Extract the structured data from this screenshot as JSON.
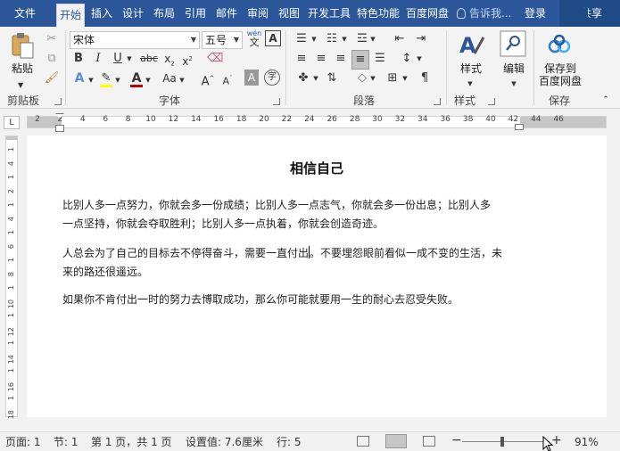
{
  "tabs": [
    {
      "label": "文件"
    },
    {
      "label": "开始"
    },
    {
      "label": "插入"
    },
    {
      "label": "设计"
    },
    {
      "label": "布局"
    },
    {
      "label": "引用"
    },
    {
      "label": "邮件"
    },
    {
      "label": "审阅"
    },
    {
      "label": "视图"
    },
    {
      "label": "开发工具"
    },
    {
      "label": "特色功能"
    },
    {
      "label": "百度网盘"
    }
  ],
  "tell_me": "告诉我...",
  "login": "登录",
  "share": "共享",
  "ribbon": {
    "clipboard": {
      "paste": "粘贴",
      "label": "剪贴板"
    },
    "font": {
      "name": "宋体",
      "size": "五号",
      "wen": "wén",
      "wen_char": "文",
      "label": "字体"
    },
    "paragraph": {
      "label": "段落"
    },
    "styles": {
      "button": "样式",
      "label": "样式"
    },
    "editing": {
      "button": "编辑"
    },
    "save": {
      "line1": "保存到",
      "line2": "百度网盘",
      "label": "保存"
    }
  },
  "ruler": {
    "corner": "L",
    "numbers": [
      "2",
      "2",
      "4",
      "6",
      "8",
      "10",
      "12",
      "14",
      "16",
      "18",
      "20",
      "22",
      "24",
      "26",
      "28",
      "30",
      "32",
      "34",
      "36",
      "38",
      "40",
      "42",
      "44",
      "46"
    ]
  },
  "vruler": {
    "numbers": [
      "1",
      "4",
      "1",
      "2",
      "1",
      "4",
      "1",
      "6",
      "1",
      "8",
      "1",
      "10",
      "1",
      "12",
      "1",
      "14",
      "1",
      "16",
      "1",
      "18"
    ]
  },
  "document": {
    "title": "相信自己",
    "para1_line1": "比别人多一点努力，你就会多一份成绩；比别人多一点志气，你就会多一份出息；比别人多",
    "para1_line2": "一点坚持，你就会夺取胜利；比别人多一点执着，你就会创造奇迹。",
    "para2_line1a": "人总会为了自己的目标去不停得奋斗，需要一直付出",
    "para2_line1b": "。不要埋怨眼前看似一成不变的生活，未",
    "para2_line2": "来的路还很遥远。",
    "para3": "如果你不肯付出一时的努力去博取成功，那么你可能就要用一生的耐心去忍受失败。"
  },
  "status": {
    "page": "页面: 1",
    "section": "节: 1",
    "pages": "第 1 页，共 1 页",
    "setting": "设置值: 7.6厘米",
    "line": "行: 5",
    "zoom": "91%",
    "minus": "−",
    "plus": "+"
  },
  "colors": {
    "accent": "#2b579a",
    "highlight": "#ffff00",
    "font_color": "#c00000"
  }
}
